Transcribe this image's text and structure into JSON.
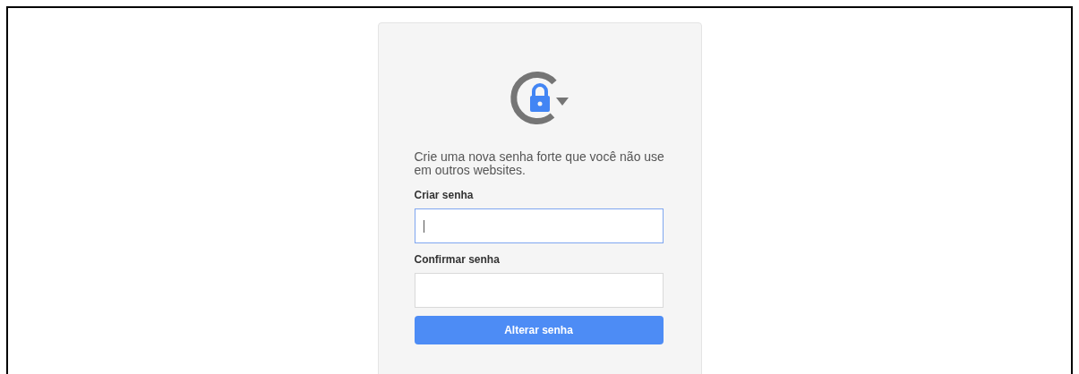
{
  "card": {
    "message": "Crie uma nova senha forte que você não use em outros websites.",
    "fields": [
      {
        "label": "Criar senha",
        "focused": true
      },
      {
        "label": "Confirmar senha",
        "focused": false
      }
    ],
    "button": "Alterar senha"
  }
}
